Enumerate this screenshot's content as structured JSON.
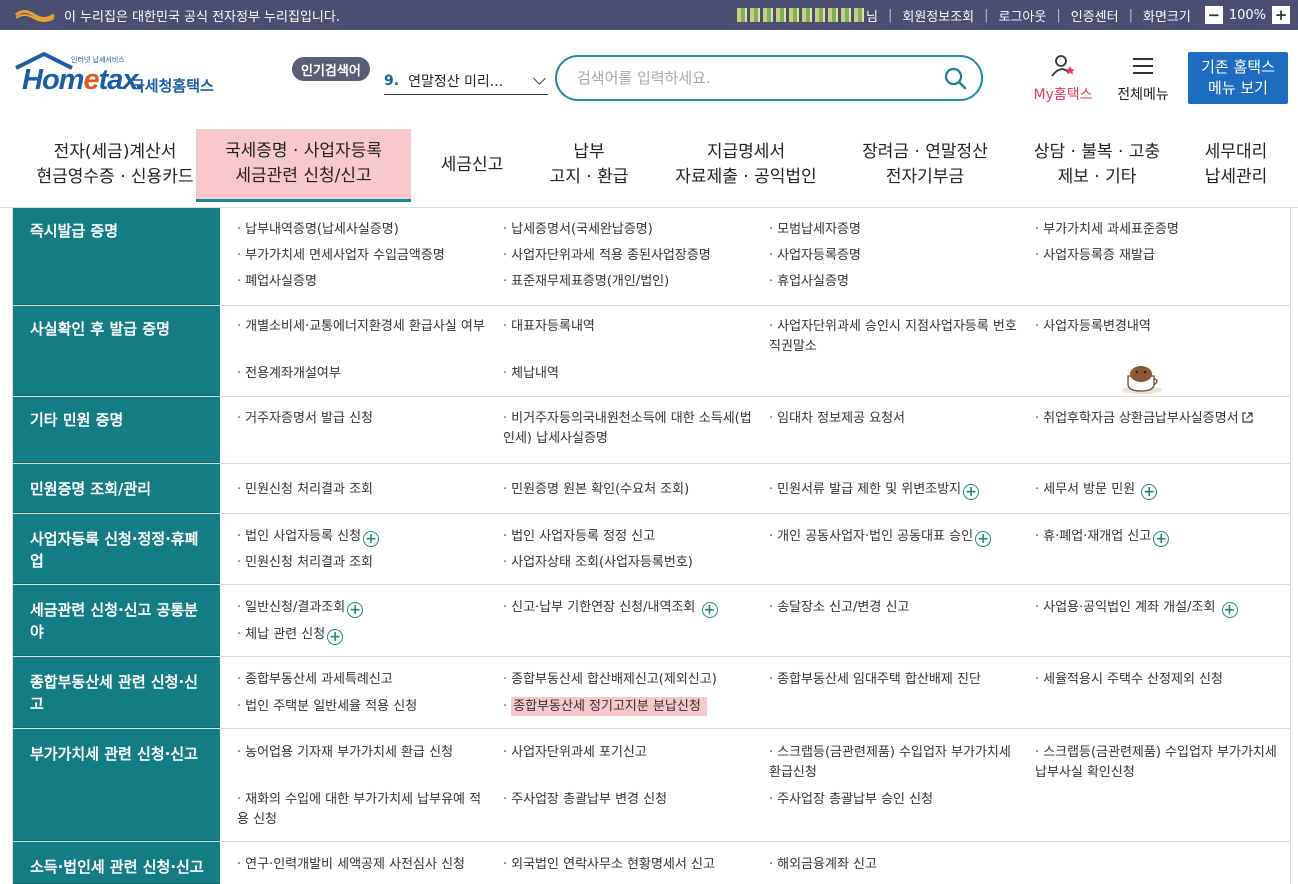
{
  "gov_banner": {
    "notice": "이 누리집은 대한민국 공식 전자정부 누리집입니다.",
    "user_suffix": "님",
    "links": [
      "회원정보조회",
      "로그아웃",
      "인증센터",
      "화면크기"
    ],
    "zoom_minus": "−",
    "zoom_value": "100%",
    "zoom_plus": "+"
  },
  "header": {
    "logo_tiny": "인터넷 납세서비스",
    "logo_word_a": "Hom",
    "logo_word_e": "e",
    "logo_word_b": "tax.",
    "logo_korean": "국세청홈택스",
    "popular_badge": "인기검색어",
    "popular_rank": "9.",
    "popular_term": "연말정산 미리...",
    "search_placeholder": "검색어를 입력하세요.",
    "my_hometax_a": "My",
    "my_hometax_b": "홈택스",
    "all_menu": "전체메뉴",
    "old_menu_line1": "기존 홈택스",
    "old_menu_line2": "메뉴 보기"
  },
  "gnb": [
    {
      "line1": "전자(세금)계산서",
      "line2": "현금영수증 · 신용카드"
    },
    {
      "line1": "국세증명 · 사업자등록",
      "line2": "세금관련 신청/신고"
    },
    {
      "line1": "세금신고",
      "line2": ""
    },
    {
      "line1": "납부",
      "line2": "고지 · 환급"
    },
    {
      "line1": "지급명세서",
      "line2": "자료제출 · 공익법인"
    },
    {
      "line1": "장려금 · 연말정산",
      "line2": "전자기부금"
    },
    {
      "line1": "상담 · 불복 · 고충",
      "line2": "제보 · 기타"
    },
    {
      "line1": "세무대리",
      "line2": "납세관리"
    }
  ],
  "rows": [
    {
      "category": "즉시발급 증명",
      "items": [
        "납부내역증명(납세사실증명)",
        "납세증명서(국세완납증명)",
        "모범납세자증명",
        "부가가치세 과세표준증명",
        "부가가치세 면세사업자 수입금액증명",
        "사업자단위과세 적용 종된사업장증명",
        "사업자등록증명",
        "사업자등록증 재발급",
        "폐업사실증명",
        "표준재무제표증명(개인/법인)",
        "휴업사실증명"
      ]
    },
    {
      "category": "사실확인 후 발급 증명",
      "items": [
        "개별소비세·교통에너지환경세 환급사실 여부",
        "대표자등록내역",
        "사업자단위과세 승인시 지점사업자등록 번호 직권말소",
        "사업자등록변경내역",
        "전용계좌개설여부",
        "체납내역"
      ]
    },
    {
      "category": "기타 민원 증명",
      "items": [
        "거주자증명서 발급 신청",
        "비거주자등의국내원천소득에 대한 소득세(법인세) 납세사실증명",
        "임대차 정보제공 요청서",
        "취업후학자금 상환금납부사실증명서"
      ]
    },
    {
      "category": "민원증명 조회/관리",
      "items": [
        "민원신청 처리결과 조회",
        "민원증명 원본 확인(수요처 조회)",
        "민원서류 발급 제한 및 위변조방지",
        "세무서 방문 민원"
      ]
    },
    {
      "category": "사업자등록 신청·정정·휴폐업",
      "items": [
        "법인 사업자등록 신청",
        "법인 사업자등록 정정 신고",
        "개인 공동사업자·법인 공동대표 승인",
        "휴·폐업·재개업 신고",
        "민원신청 처리결과 조회",
        "사업자상태 조회(사업자등록번호)"
      ]
    },
    {
      "category": "세금관련 신청·신고 공통분야",
      "items": [
        "일반신청/결과조회",
        "신고·납부 기한연장 신청/내역조회",
        "송달장소 신고/변경 신고",
        "사업용·공익법인 계좌 개설/조회",
        "체납 관련 신청"
      ]
    },
    {
      "category": "종합부동산세 관련 신청·신고",
      "items": [
        "종합부동산세 과세특례신고",
        "종합부동산세 합산배제신고(제외신고)",
        "종합부동산세 임대주택 합산배제 진단",
        "세율적용시 주택수 산정제외 신청",
        "법인 주택분 일반세율 적용 신청",
        "종합부동산세 정기고지분 분납신청"
      ]
    },
    {
      "category": "부가가치세 관련 신청·신고",
      "items": [
        "농어업용 기자재 부가가치세 환급 신청",
        "사업자단위과세 포기신고",
        "스크랩등(금관련제품) 수입업자 부가가치세 환급신청",
        "스크랩등(금관련제품) 수입업자 부가가치세 납부사실 확인신청",
        "재화의 수입에 대한 부가가치세 납부유예 적용 신청",
        "주사업장 총괄납부 변경 신청",
        "주사업장 총괄납부 승인 신청"
      ]
    },
    {
      "category": "소득·법인세 관련 신청·신고",
      "items": [
        "연구·인력개발비 세액공제 사전심사 신청",
        "외국법인 연락사무소 현황명세서 신고",
        "해외금융계좌 신고"
      ]
    }
  ],
  "colors": {
    "category_bg": "#147d84",
    "highlight": "#f7c9cc",
    "brand_blue": "#1a5ea8",
    "gov_bar": "#4a4e71",
    "search_border": "#1d8fa6"
  }
}
